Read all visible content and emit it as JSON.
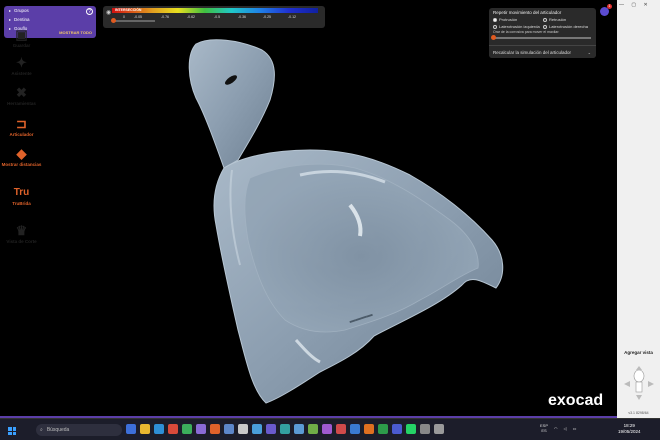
{
  "groups_panel": {
    "items": [
      {
        "label": "Grupos"
      },
      {
        "label": "Dentina"
      },
      {
        "label": "Gouflo"
      }
    ],
    "show_all_label": "MOSTRAR TODO"
  },
  "color_scale": {
    "title": "INTERSECCIÓN",
    "ticks": [
      "0",
      "-0.05",
      "-0.76",
      "-0.62",
      "-0.5",
      "-0.36",
      "-0.25",
      "-0.12"
    ]
  },
  "articulator_panel": {
    "title": "Repetir movimiento del articulador",
    "options": [
      {
        "label": "Protrusión",
        "selected": true
      },
      {
        "label": "Retrusión",
        "selected": false
      },
      {
        "label": "Laterotrusión izquierda",
        "selected": false
      },
      {
        "label": "Laterotrusión derecha",
        "selected": false
      }
    ],
    "slider_label": "Orar de la corrosiva para mover el maxilar:",
    "recalc_label": "Recalcular la simulación del articulador"
  },
  "user": {
    "notifications": "1"
  },
  "sidebar": {
    "items": [
      {
        "label": "Guardar",
        "icon": "save-icon",
        "glyph": "💾",
        "accent": false
      },
      {
        "label": "Asistente",
        "icon": "wizard-wand-icon",
        "glyph": "✦",
        "accent": false
      },
      {
        "label": "Herramientas",
        "icon": "tools-icon",
        "glyph": "✂",
        "accent": false
      },
      {
        "label": "Articulador",
        "icon": "articulator-icon",
        "glyph": "⊐",
        "accent": true
      },
      {
        "label": "Mostrar distancias",
        "icon": "distances-icon",
        "glyph": "◆",
        "accent": true
      },
      {
        "label": "TruBrida",
        "icon": "trubrida-icon",
        "glyph": "Tru",
        "accent": true
      },
      {
        "label": "Vista de Corte",
        "icon": "cut-view-icon",
        "glyph": "♛",
        "accent": false
      }
    ],
    "add_view_label": "Agregar vista",
    "version": "v3.1 8298/64"
  },
  "logo": "exocad",
  "taskbar": {
    "search_placeholder": "Búsqueda",
    "tray": {
      "lang": "ESP",
      "region": "ES"
    },
    "time": "18:29",
    "date": "19/05/2024"
  },
  "colors": {
    "accent": "#e0622a",
    "panel_purple": "#5b3ea8",
    "model_surface": "#8fa2b4"
  }
}
